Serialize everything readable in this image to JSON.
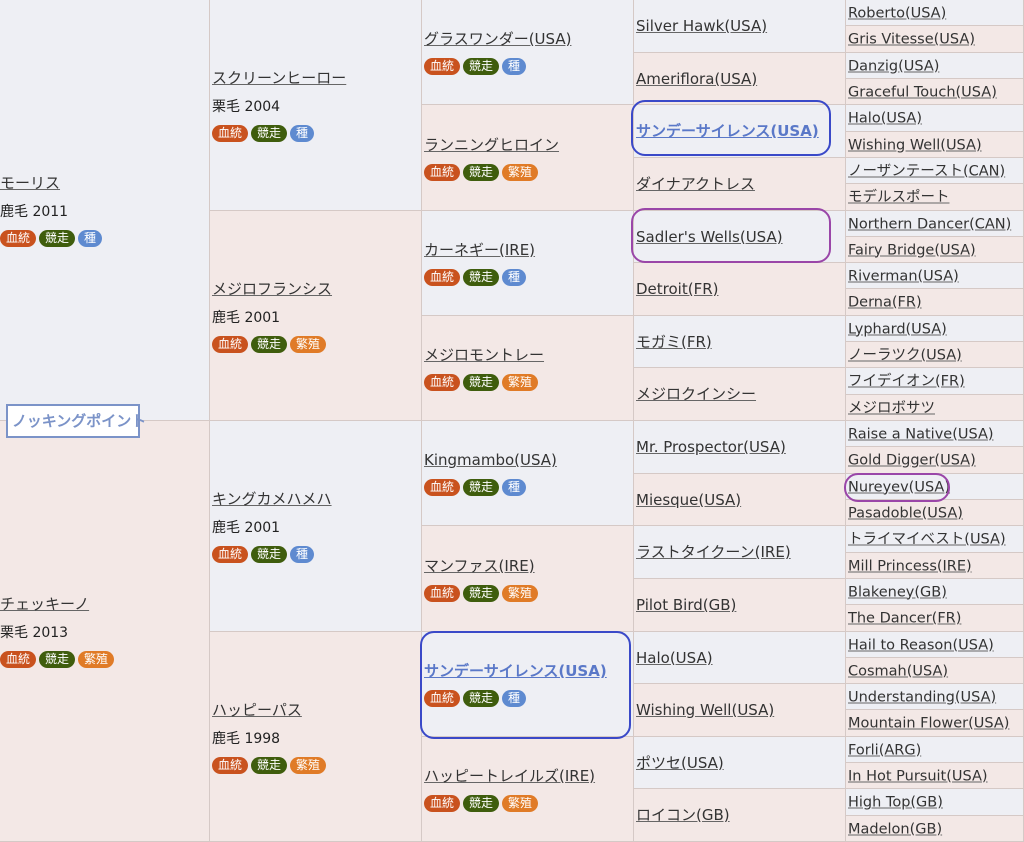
{
  "badge_labels": {
    "blood": "血統",
    "race": "競走",
    "sire": "種",
    "breed": "繁殖"
  },
  "cross_label": "ノッキングポイント",
  "gen1": [
    {
      "name": "モーリス",
      "info": "鹿毛 2011",
      "badges": [
        "blood",
        "race",
        "sire"
      ]
    },
    {
      "name": "チェッキーノ",
      "info": "栗毛 2013",
      "badges": [
        "blood",
        "race",
        "breed"
      ]
    }
  ],
  "gen2": [
    {
      "name": "スクリーンヒーロー",
      "info": "栗毛 2004",
      "badges": [
        "blood",
        "race",
        "sire"
      ]
    },
    {
      "name": "メジロフランシス",
      "info": "鹿毛 2001",
      "badges": [
        "blood",
        "race",
        "breed"
      ]
    },
    {
      "name": "キングカメハメハ",
      "info": "鹿毛 2001",
      "badges": [
        "blood",
        "race",
        "sire"
      ]
    },
    {
      "name": "ハッピーパス",
      "info": "鹿毛 1998",
      "badges": [
        "blood",
        "race",
        "breed"
      ]
    }
  ],
  "gen3": [
    {
      "name": "グラスワンダー(USA)",
      "badges": [
        "blood",
        "race",
        "sire"
      ]
    },
    {
      "name": "ランニングヒロイン",
      "badges": [
        "blood",
        "race",
        "breed"
      ]
    },
    {
      "name": "カーネギー(IRE)",
      "badges": [
        "blood",
        "race",
        "sire"
      ]
    },
    {
      "name": "メジロモントレー",
      "badges": [
        "blood",
        "race",
        "breed"
      ]
    },
    {
      "name": "Kingmambo(USA)",
      "badges": [
        "blood",
        "race",
        "sire"
      ]
    },
    {
      "name": "マンファス(IRE)",
      "badges": [
        "blood",
        "race",
        "breed"
      ]
    },
    {
      "name": "サンデーサイレンス(USA)",
      "badges": [
        "blood",
        "race",
        "sire"
      ],
      "highlight": true
    },
    {
      "name": "ハッピートレイルズ(IRE)",
      "badges": [
        "blood",
        "race",
        "breed"
      ]
    }
  ],
  "gen4": [
    {
      "name": "Silver Hawk(USA)"
    },
    {
      "name": "Ameriflora(USA)"
    },
    {
      "name": "サンデーサイレンス(USA)",
      "highlight": true
    },
    {
      "name": "ダイナアクトレス"
    },
    {
      "name": "Sadler's Wells(USA)"
    },
    {
      "name": "Detroit(FR)"
    },
    {
      "name": "モガミ(FR)"
    },
    {
      "name": "メジロクインシー"
    },
    {
      "name": "Mr. Prospector(USA)"
    },
    {
      "name": "Miesque(USA)"
    },
    {
      "name": "ラストタイクーン(IRE)"
    },
    {
      "name": "Pilot Bird(GB)"
    },
    {
      "name": "Halo(USA)"
    },
    {
      "name": "Wishing Well(USA)"
    },
    {
      "name": "ポツセ(USA)"
    },
    {
      "name": "ロイコン(GB)"
    }
  ],
  "gen5": [
    "Roberto(USA)",
    "Gris Vitesse(USA)",
    "Danzig(USA)",
    "Graceful Touch(USA)",
    "Halo(USA)",
    "Wishing Well(USA)",
    "ノーザンテースト(CAN)",
    "モデルスポート",
    "Northern Dancer(CAN)",
    "Fairy Bridge(USA)",
    "Riverman(USA)",
    "Derna(FR)",
    "Lyphard(USA)",
    "ノーラツク(USA)",
    "フイデイオン(FR)",
    "メジロボサツ",
    "Raise a Native(USA)",
    "Gold Digger(USA)",
    "Nureyev(USA)",
    "Pasadoble(USA)",
    "トライマイベスト(USA)",
    "Mill Princess(IRE)",
    "Blakeney(GB)",
    "The Dancer(FR)",
    "Hail to Reason(USA)",
    "Cosmah(USA)",
    "Understanding(USA)",
    "Mountain Flower(USA)",
    "Forli(ARG)",
    "In Hot Pursuit(USA)",
    "High Top(GB)",
    "Madelon(GB)"
  ]
}
